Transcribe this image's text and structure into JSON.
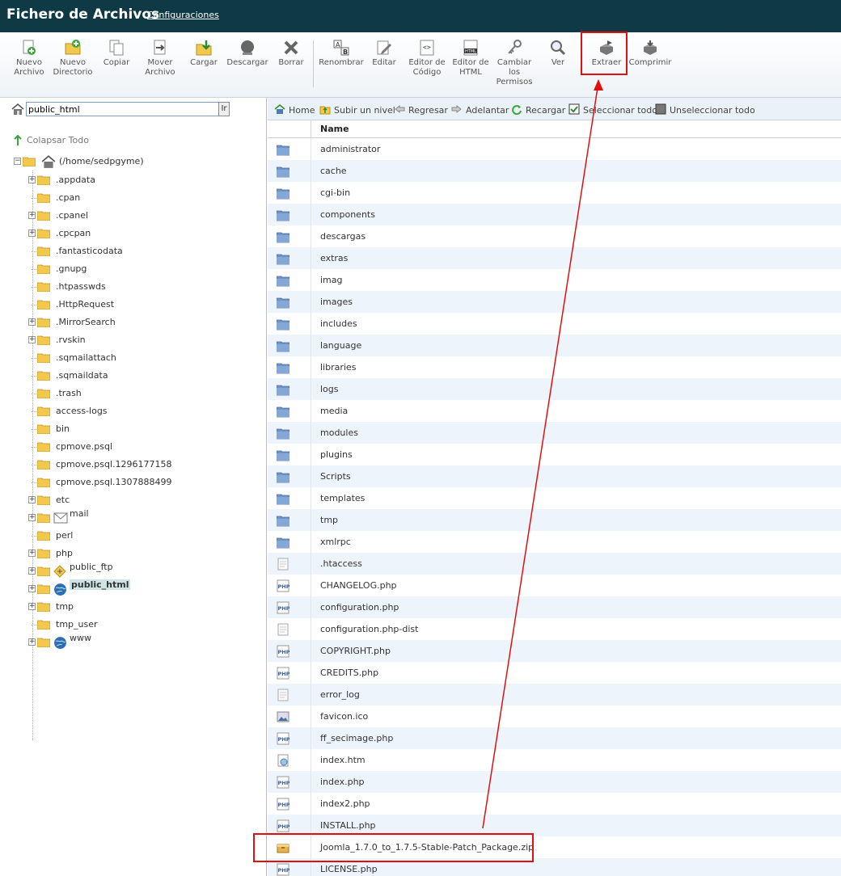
{
  "header": {
    "title": "Fichero de Archivos",
    "settings_link": "Configuraciones"
  },
  "toolbar": {
    "buttons": [
      {
        "label": "Nuevo Archivo"
      },
      {
        "label": "Nuevo Directorio"
      },
      {
        "label": "Copiar"
      },
      {
        "label": "Mover Archivo"
      },
      {
        "label": "Cargar"
      },
      {
        "label": "Descargar"
      },
      {
        "label": "Borrar"
      },
      {
        "label": "Renombrar"
      },
      {
        "label": "Editar"
      },
      {
        "label": "Editor de Código"
      },
      {
        "label": "Editor de HTML"
      },
      {
        "label": "Cambiar los Permisos"
      },
      {
        "label": "Ver"
      },
      {
        "label": "Extraer"
      },
      {
        "label": "Comprimir"
      }
    ]
  },
  "sidebar": {
    "path_value": "public_html",
    "go_label": "Ir",
    "collapse_label": "Colapsar Todo",
    "root_label": "(/home/sedpgyme)",
    "items": [
      {
        "label": ".appdata"
      },
      {
        "label": ".cpan"
      },
      {
        "label": ".cpanel"
      },
      {
        "label": ".cpcpan"
      },
      {
        "label": ".fantasticodata"
      },
      {
        "label": ".gnupg"
      },
      {
        "label": ".htpasswds"
      },
      {
        "label": ".HttpRequest"
      },
      {
        "label": ".MirrorSearch"
      },
      {
        "label": ".rvskin"
      },
      {
        "label": ".sqmailattach"
      },
      {
        "label": ".sqmaildata"
      },
      {
        "label": ".trash"
      },
      {
        "label": "access-logs"
      },
      {
        "label": "bin"
      },
      {
        "label": "cpmove.psql"
      },
      {
        "label": "cpmove.psql.1296177158"
      },
      {
        "label": "cpmove.psql.1307888499"
      },
      {
        "label": "etc"
      },
      {
        "label": "mail"
      },
      {
        "label": "perl"
      },
      {
        "label": "php"
      },
      {
        "label": "public_ftp"
      },
      {
        "label": "public_html"
      },
      {
        "label": "tmp"
      },
      {
        "label": "tmp_user"
      },
      {
        "label": "www"
      }
    ]
  },
  "navbar": {
    "home": "Home",
    "up": "Subir un nivel",
    "back": "Regresar",
    "forward": "Adelantar",
    "reload": "Recargar",
    "select_all": "Seleccionar todo",
    "unselect_all": "Unseleccionar todo"
  },
  "table": {
    "header_name": "Name",
    "rows": [
      {
        "name": "administrator",
        "type": "folder"
      },
      {
        "name": "cache",
        "type": "folder"
      },
      {
        "name": "cgi-bin",
        "type": "folder"
      },
      {
        "name": "components",
        "type": "folder"
      },
      {
        "name": "descargas",
        "type": "folder"
      },
      {
        "name": "extras",
        "type": "folder"
      },
      {
        "name": "imag",
        "type": "folder"
      },
      {
        "name": "images",
        "type": "folder"
      },
      {
        "name": "includes",
        "type": "folder"
      },
      {
        "name": "language",
        "type": "folder"
      },
      {
        "name": "libraries",
        "type": "folder"
      },
      {
        "name": "logs",
        "type": "folder"
      },
      {
        "name": "media",
        "type": "folder"
      },
      {
        "name": "modules",
        "type": "folder"
      },
      {
        "name": "plugins",
        "type": "folder"
      },
      {
        "name": "Scripts",
        "type": "folder"
      },
      {
        "name": "templates",
        "type": "folder"
      },
      {
        "name": "tmp",
        "type": "folder"
      },
      {
        "name": "xmlrpc",
        "type": "folder"
      },
      {
        "name": ".htaccess",
        "type": "text"
      },
      {
        "name": "CHANGELOG.php",
        "type": "php"
      },
      {
        "name": "configuration.php",
        "type": "php"
      },
      {
        "name": "configuration.php-dist",
        "type": "text"
      },
      {
        "name": "COPYRIGHT.php",
        "type": "php"
      },
      {
        "name": "CREDITS.php",
        "type": "php"
      },
      {
        "name": "error_log",
        "type": "text"
      },
      {
        "name": "favicon.ico",
        "type": "image"
      },
      {
        "name": "ff_secimage.php",
        "type": "php"
      },
      {
        "name": "index.htm",
        "type": "html"
      },
      {
        "name": "index.php",
        "type": "php"
      },
      {
        "name": "index2.php",
        "type": "php"
      },
      {
        "name": "INSTALL.php",
        "type": "php"
      },
      {
        "name": "Joomla_1.7.0_to_1.7.5-Stable-Patch_Package.zip",
        "type": "zip"
      },
      {
        "name": "LICENSE.php",
        "type": "php"
      }
    ]
  },
  "colors": {
    "header_bg": "#0f3a45",
    "annotation": "#e01010",
    "row_alt": "#eef4fb"
  }
}
